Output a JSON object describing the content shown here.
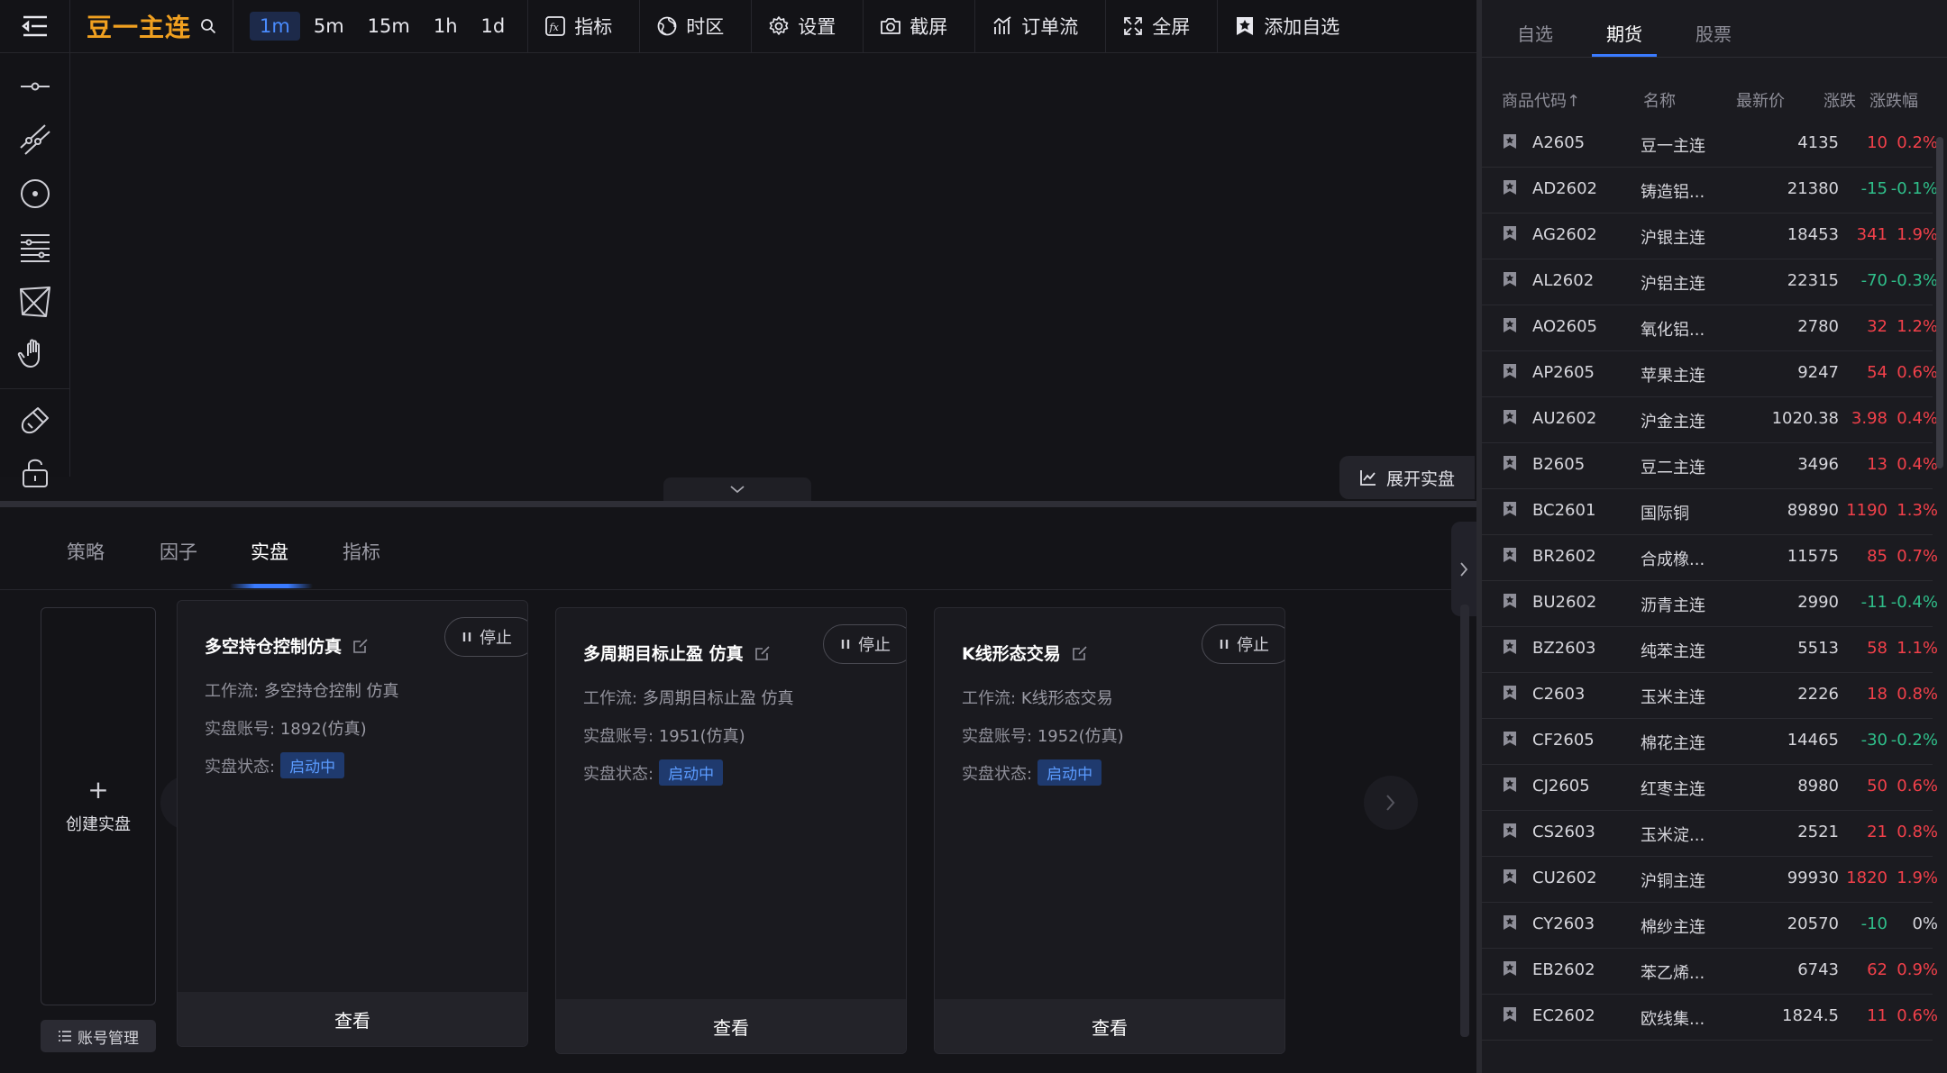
{
  "toolbar": {
    "symbol": "豆一主连",
    "intervals": [
      "1m",
      "5m",
      "15m",
      "1h",
      "1d"
    ],
    "active_interval": "1m",
    "buttons": {
      "indicator": "指标",
      "timezone": "时区",
      "settings": "设置",
      "screenshot": "截屏",
      "orderflow": "订单流",
      "fullscreen": "全屏",
      "watchlist": "添加自选"
    }
  },
  "chart": {
    "expand_live_label": "展开实盘"
  },
  "bottom_panel": {
    "tabs": [
      "策略",
      "因子",
      "实盘",
      "指标"
    ],
    "active_tab": "实盘",
    "create_label": "创建实盘",
    "account_mgmt_label": "账号管理",
    "stop_label": "停止",
    "view_label": "查看",
    "cards": [
      {
        "title": "多空持仓控制仿真",
        "workflow_label": "工作流:",
        "workflow": "多空持仓控制 仿真",
        "account_label": "实盘账号:",
        "account": "1892(仿真)",
        "status_label": "实盘状态:",
        "status": "启动中"
      },
      {
        "title": "多周期目标止盈 仿真",
        "workflow_label": "工作流:",
        "workflow": "多周期目标止盈 仿真",
        "account_label": "实盘账号:",
        "account": "1951(仿真)",
        "status_label": "实盘状态:",
        "status": "启动中"
      },
      {
        "title": "K线形态交易",
        "workflow_label": "工作流:",
        "workflow": "K线形态交易",
        "account_label": "实盘账号:",
        "account": "1952(仿真)",
        "status_label": "实盘状态:",
        "status": "启动中"
      }
    ]
  },
  "market": {
    "tabs": [
      "自选",
      "期货",
      "股票"
    ],
    "active_tab": "期货",
    "columns": [
      "商品代码↑",
      "名称",
      "最新价",
      "涨跌",
      "涨跌幅"
    ],
    "colors": {
      "up": "#f2404a",
      "down": "#2fbf8a"
    },
    "rows": [
      {
        "code": "A2605",
        "name": "豆一主连",
        "price": "4135",
        "change": "10",
        "pct": "0.2%",
        "dir": "up"
      },
      {
        "code": "AD2602",
        "name": "铸造铝...",
        "price": "21380",
        "change": "-15",
        "pct": "-0.1%",
        "dir": "down"
      },
      {
        "code": "AG2602",
        "name": "沪银主连",
        "price": "18453",
        "change": "341",
        "pct": "1.9%",
        "dir": "up"
      },
      {
        "code": "AL2602",
        "name": "沪铝主连",
        "price": "22315",
        "change": "-70",
        "pct": "-0.3%",
        "dir": "down"
      },
      {
        "code": "AO2605",
        "name": "氧化铝...",
        "price": "2780",
        "change": "32",
        "pct": "1.2%",
        "dir": "up"
      },
      {
        "code": "AP2605",
        "name": "苹果主连",
        "price": "9247",
        "change": "54",
        "pct": "0.6%",
        "dir": "up"
      },
      {
        "code": "AU2602",
        "name": "沪金主连",
        "price": "1020.38",
        "change": "3.98",
        "pct": "0.4%",
        "dir": "up"
      },
      {
        "code": "B2605",
        "name": "豆二主连",
        "price": "3496",
        "change": "13",
        "pct": "0.4%",
        "dir": "up"
      },
      {
        "code": "BC2601",
        "name": "国际铜",
        "price": "89890",
        "change": "1190",
        "pct": "1.3%",
        "dir": "up"
      },
      {
        "code": "BR2602",
        "name": "合成橡...",
        "price": "11575",
        "change": "85",
        "pct": "0.7%",
        "dir": "up"
      },
      {
        "code": "BU2602",
        "name": "沥青主连",
        "price": "2990",
        "change": "-11",
        "pct": "-0.4%",
        "dir": "down"
      },
      {
        "code": "BZ2603",
        "name": "纯苯主连",
        "price": "5513",
        "change": "58",
        "pct": "1.1%",
        "dir": "up"
      },
      {
        "code": "C2603",
        "name": "玉米主连",
        "price": "2226",
        "change": "18",
        "pct": "0.8%",
        "dir": "up"
      },
      {
        "code": "CF2605",
        "name": "棉花主连",
        "price": "14465",
        "change": "-30",
        "pct": "-0.2%",
        "dir": "down"
      },
      {
        "code": "CJ2605",
        "name": "红枣主连",
        "price": "8980",
        "change": "50",
        "pct": "0.6%",
        "dir": "up"
      },
      {
        "code": "CS2603",
        "name": "玉米淀...",
        "price": "2521",
        "change": "21",
        "pct": "0.8%",
        "dir": "up"
      },
      {
        "code": "CU2602",
        "name": "沪铜主连",
        "price": "99930",
        "change": "1820",
        "pct": "1.9%",
        "dir": "up"
      },
      {
        "code": "CY2603",
        "name": "棉纱主连",
        "price": "20570",
        "change": "-10",
        "pct": "0%",
        "dir": "down"
      },
      {
        "code": "EB2602",
        "name": "苯乙烯...",
        "price": "6743",
        "change": "62",
        "pct": "0.9%",
        "dir": "up"
      },
      {
        "code": "EC2602",
        "name": "欧线集...",
        "price": "1824.5",
        "change": "11",
        "pct": "0.6%",
        "dir": "up"
      }
    ]
  }
}
